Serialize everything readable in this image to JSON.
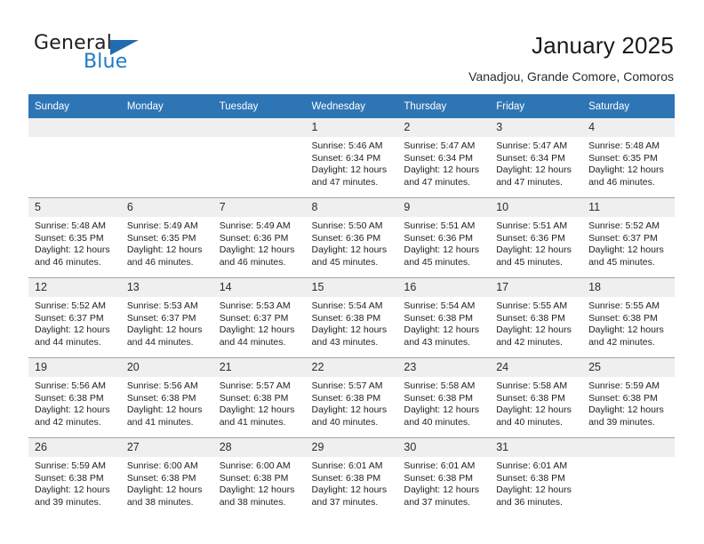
{
  "brand": {
    "name_part1": "General",
    "name_part2": "Blue",
    "logo_icon": "triangle-logo-icon"
  },
  "header": {
    "title": "January 2025",
    "subtitle": "Vanadjou, Grande Comore, Comoros"
  },
  "colors": {
    "header_band": "#2e75b6",
    "daynum_band": "#efefef",
    "brand_blue": "#1f7bc1",
    "row_divider": "#9fa3a6"
  },
  "calendar": {
    "weekday_headers": [
      "Sunday",
      "Monday",
      "Tuesday",
      "Wednesday",
      "Thursday",
      "Friday",
      "Saturday"
    ],
    "weeks": [
      [
        {
          "day": "",
          "empty": true,
          "lines": []
        },
        {
          "day": "",
          "empty": true,
          "lines": []
        },
        {
          "day": "",
          "empty": true,
          "lines": []
        },
        {
          "day": "1",
          "empty": false,
          "lines": [
            "Sunrise: 5:46 AM",
            "Sunset: 6:34 PM",
            "Daylight: 12 hours",
            "and 47 minutes."
          ]
        },
        {
          "day": "2",
          "empty": false,
          "lines": [
            "Sunrise: 5:47 AM",
            "Sunset: 6:34 PM",
            "Daylight: 12 hours",
            "and 47 minutes."
          ]
        },
        {
          "day": "3",
          "empty": false,
          "lines": [
            "Sunrise: 5:47 AM",
            "Sunset: 6:34 PM",
            "Daylight: 12 hours",
            "and 47 minutes."
          ]
        },
        {
          "day": "4",
          "empty": false,
          "lines": [
            "Sunrise: 5:48 AM",
            "Sunset: 6:35 PM",
            "Daylight: 12 hours",
            "and 46 minutes."
          ]
        }
      ],
      [
        {
          "day": "5",
          "empty": false,
          "lines": [
            "Sunrise: 5:48 AM",
            "Sunset: 6:35 PM",
            "Daylight: 12 hours",
            "and 46 minutes."
          ]
        },
        {
          "day": "6",
          "empty": false,
          "lines": [
            "Sunrise: 5:49 AM",
            "Sunset: 6:35 PM",
            "Daylight: 12 hours",
            "and 46 minutes."
          ]
        },
        {
          "day": "7",
          "empty": false,
          "lines": [
            "Sunrise: 5:49 AM",
            "Sunset: 6:36 PM",
            "Daylight: 12 hours",
            "and 46 minutes."
          ]
        },
        {
          "day": "8",
          "empty": false,
          "lines": [
            "Sunrise: 5:50 AM",
            "Sunset: 6:36 PM",
            "Daylight: 12 hours",
            "and 45 minutes."
          ]
        },
        {
          "day": "9",
          "empty": false,
          "lines": [
            "Sunrise: 5:51 AM",
            "Sunset: 6:36 PM",
            "Daylight: 12 hours",
            "and 45 minutes."
          ]
        },
        {
          "day": "10",
          "empty": false,
          "lines": [
            "Sunrise: 5:51 AM",
            "Sunset: 6:36 PM",
            "Daylight: 12 hours",
            "and 45 minutes."
          ]
        },
        {
          "day": "11",
          "empty": false,
          "lines": [
            "Sunrise: 5:52 AM",
            "Sunset: 6:37 PM",
            "Daylight: 12 hours",
            "and 45 minutes."
          ]
        }
      ],
      [
        {
          "day": "12",
          "empty": false,
          "lines": [
            "Sunrise: 5:52 AM",
            "Sunset: 6:37 PM",
            "Daylight: 12 hours",
            "and 44 minutes."
          ]
        },
        {
          "day": "13",
          "empty": false,
          "lines": [
            "Sunrise: 5:53 AM",
            "Sunset: 6:37 PM",
            "Daylight: 12 hours",
            "and 44 minutes."
          ]
        },
        {
          "day": "14",
          "empty": false,
          "lines": [
            "Sunrise: 5:53 AM",
            "Sunset: 6:37 PM",
            "Daylight: 12 hours",
            "and 44 minutes."
          ]
        },
        {
          "day": "15",
          "empty": false,
          "lines": [
            "Sunrise: 5:54 AM",
            "Sunset: 6:38 PM",
            "Daylight: 12 hours",
            "and 43 minutes."
          ]
        },
        {
          "day": "16",
          "empty": false,
          "lines": [
            "Sunrise: 5:54 AM",
            "Sunset: 6:38 PM",
            "Daylight: 12 hours",
            "and 43 minutes."
          ]
        },
        {
          "day": "17",
          "empty": false,
          "lines": [
            "Sunrise: 5:55 AM",
            "Sunset: 6:38 PM",
            "Daylight: 12 hours",
            "and 42 minutes."
          ]
        },
        {
          "day": "18",
          "empty": false,
          "lines": [
            "Sunrise: 5:55 AM",
            "Sunset: 6:38 PM",
            "Daylight: 12 hours",
            "and 42 minutes."
          ]
        }
      ],
      [
        {
          "day": "19",
          "empty": false,
          "lines": [
            "Sunrise: 5:56 AM",
            "Sunset: 6:38 PM",
            "Daylight: 12 hours",
            "and 42 minutes."
          ]
        },
        {
          "day": "20",
          "empty": false,
          "lines": [
            "Sunrise: 5:56 AM",
            "Sunset: 6:38 PM",
            "Daylight: 12 hours",
            "and 41 minutes."
          ]
        },
        {
          "day": "21",
          "empty": false,
          "lines": [
            "Sunrise: 5:57 AM",
            "Sunset: 6:38 PM",
            "Daylight: 12 hours",
            "and 41 minutes."
          ]
        },
        {
          "day": "22",
          "empty": false,
          "lines": [
            "Sunrise: 5:57 AM",
            "Sunset: 6:38 PM",
            "Daylight: 12 hours",
            "and 40 minutes."
          ]
        },
        {
          "day": "23",
          "empty": false,
          "lines": [
            "Sunrise: 5:58 AM",
            "Sunset: 6:38 PM",
            "Daylight: 12 hours",
            "and 40 minutes."
          ]
        },
        {
          "day": "24",
          "empty": false,
          "lines": [
            "Sunrise: 5:58 AM",
            "Sunset: 6:38 PM",
            "Daylight: 12 hours",
            "and 40 minutes."
          ]
        },
        {
          "day": "25",
          "empty": false,
          "lines": [
            "Sunrise: 5:59 AM",
            "Sunset: 6:38 PM",
            "Daylight: 12 hours",
            "and 39 minutes."
          ]
        }
      ],
      [
        {
          "day": "26",
          "empty": false,
          "lines": [
            "Sunrise: 5:59 AM",
            "Sunset: 6:38 PM",
            "Daylight: 12 hours",
            "and 39 minutes."
          ]
        },
        {
          "day": "27",
          "empty": false,
          "lines": [
            "Sunrise: 6:00 AM",
            "Sunset: 6:38 PM",
            "Daylight: 12 hours",
            "and 38 minutes."
          ]
        },
        {
          "day": "28",
          "empty": false,
          "lines": [
            "Sunrise: 6:00 AM",
            "Sunset: 6:38 PM",
            "Daylight: 12 hours",
            "and 38 minutes."
          ]
        },
        {
          "day": "29",
          "empty": false,
          "lines": [
            "Sunrise: 6:01 AM",
            "Sunset: 6:38 PM",
            "Daylight: 12 hours",
            "and 37 minutes."
          ]
        },
        {
          "day": "30",
          "empty": false,
          "lines": [
            "Sunrise: 6:01 AM",
            "Sunset: 6:38 PM",
            "Daylight: 12 hours",
            "and 37 minutes."
          ]
        },
        {
          "day": "31",
          "empty": false,
          "lines": [
            "Sunrise: 6:01 AM",
            "Sunset: 6:38 PM",
            "Daylight: 12 hours",
            "and 36 minutes."
          ]
        },
        {
          "day": "",
          "empty": true,
          "lines": []
        }
      ]
    ]
  }
}
